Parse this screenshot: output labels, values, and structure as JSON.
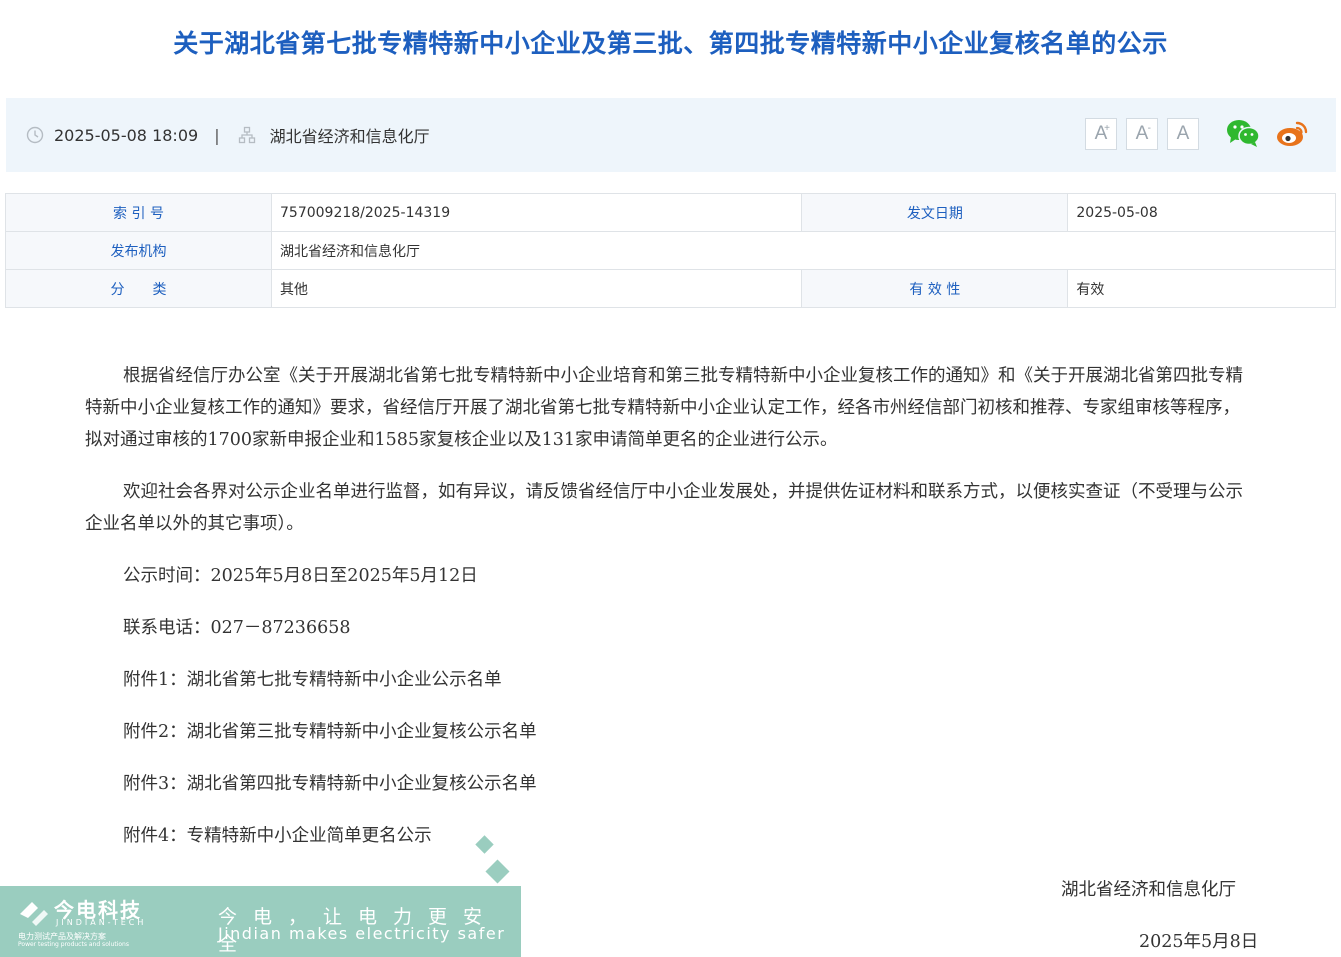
{
  "article": {
    "title": "关于湖北省第七批专精特新中小企业及第三批、第四批专精特新中小企业复核名单的公示"
  },
  "meta": {
    "datetime": "2025-05-08 18:09",
    "separator": "|",
    "publisher": "湖北省经济和信息化厅"
  },
  "font_size_buttons": [
    "A",
    "A",
    "A"
  ],
  "info_table": {
    "rows": [
      {
        "label1": "索 引 号",
        "value1": "757009218/2025-14319",
        "label2": "发文日期",
        "value2": "2025-05-08"
      },
      {
        "label1": "发布机构",
        "value1": "湖北省经济和信息化厅"
      },
      {
        "label1": "分　　类",
        "value1": "其他",
        "label2": "有 效 性",
        "value2": "有效"
      }
    ]
  },
  "body": {
    "paragraphs": [
      "根据省经信厅办公室《关于开展湖北省第七批专精特新中小企业培育和第三批专精特新中小企业复核工作的通知》和《关于开展湖北省第四批专精特新中小企业复核工作的通知》要求，省经信厅开展了湖北省第七批专精特新中小企业认定工作，经各市州经信部门初核和推荐、专家组审核等程序，拟对通过审核的1700家新申报企业和1585家复核企业以及131家申请简单更名的企业进行公示。",
      "欢迎社会各界对公示企业名单进行监督，如有异议，请反馈省经信厅中小企业发展处，并提供佐证材料和联系方式，以便核实查证（不受理与公示企业名单以外的其它事项）。"
    ],
    "lines": [
      "公示时间：2025年5月8日至2025年5月12日",
      "联系电话：027－87236658",
      "附件1：湖北省第七批专精特新中小企业公示名单",
      "附件2：湖北省第三批专精特新中小企业复核公示名单",
      "附件3：湖北省第四批专精特新中小企业复核公示名单",
      "附件4：专精特新中小企业简单更名公示"
    ],
    "signature": "湖北省经济和信息化厅",
    "sign_date": "2025年5月8日"
  },
  "watermark": {
    "brand": "今电科技",
    "brand_en": "JINDIAN-TECH",
    "brand_sub": "电力测试产品及解决方案",
    "brand_sub_en": "Power testing products and solutions",
    "slogan": "今电，让电力更安全",
    "slogan_en": "Jindian makes electricity safer"
  },
  "icons": {
    "clock": "clock-icon",
    "org": "org-chart-icon",
    "wechat": "wechat-icon",
    "weibo": "weibo-icon"
  },
  "colors": {
    "title": "#1d5fbf",
    "meta_bg": "#eef5fb",
    "table_label": "#1d5fbf",
    "wechat": "#2fb82f",
    "weibo": "#e8731b"
  }
}
